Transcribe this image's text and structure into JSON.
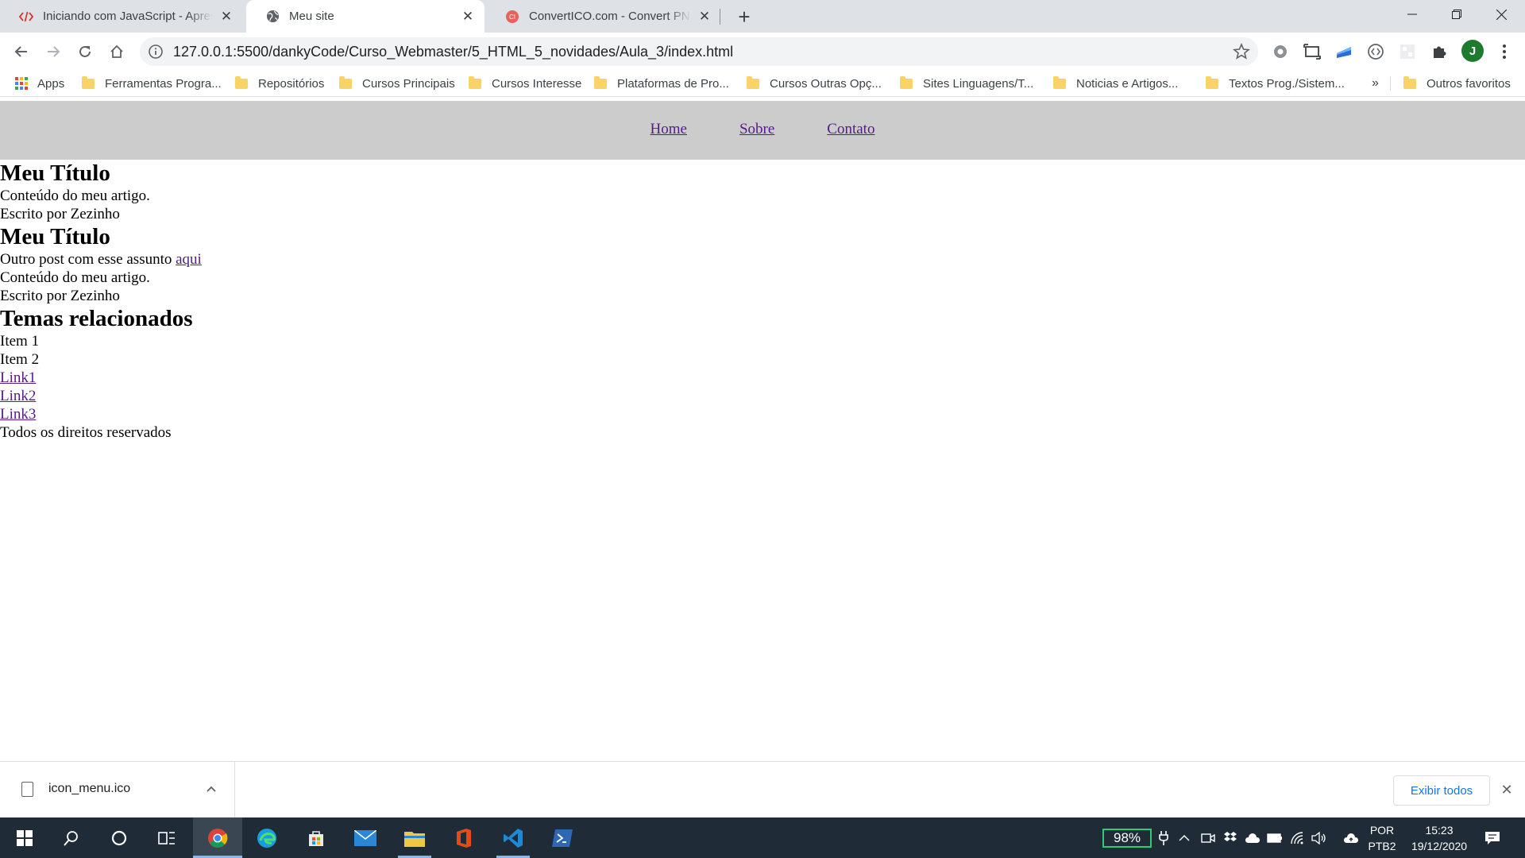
{
  "browser": {
    "tabs": [
      {
        "title": "Iniciando com JavaScript - Apres",
        "icon": "code-icon",
        "active": false
      },
      {
        "title": "Meu site",
        "icon": "globe-icon",
        "active": true
      },
      {
        "title": "ConvertICO.com - Convert PNG t",
        "icon": "converticon-icon",
        "active": false
      }
    ],
    "url": "127.0.0.1:5500/dankyCode/Curso_Webmaster/5_HTML_5_novidades/Aula_3/index.html",
    "avatar_letter": "J",
    "bookmarks": [
      "Apps",
      "Ferramentas Progra...",
      "Repositórios",
      "Cursos Principais",
      "Cursos Interesse",
      "Plataformas de Pro...",
      "Cursos Outras Opç...",
      "Sites Linguagens/T...",
      "Noticias e Artigos...",
      "Textos Prog./Sistem..."
    ],
    "bookmarks_more": "»",
    "bookmarks_other": "Outros favoritos"
  },
  "page": {
    "nav": [
      "Home",
      "Sobre",
      "Contato"
    ],
    "article1": {
      "title": "Meu Título",
      "content": "Conteúdo do meu artigo.",
      "author": "Escrito por Zezinho"
    },
    "article2": {
      "title": "Meu Título",
      "related_text": "Outro post com esse assunto",
      "related_link": "aqui",
      "content": "Conteúdo do meu artigo.",
      "author": "Escrito por Zezinho"
    },
    "aside": {
      "title": "Temas relacionados",
      "items": [
        "Item 1",
        "Item 2"
      ],
      "links": [
        "Link1",
        "Link2",
        "Link3"
      ]
    },
    "footer": "Todos os direitos reservados",
    "link_color": "#551a8b",
    "nav_bg": "#cccccc"
  },
  "downloads": {
    "file": "icon_menu.ico",
    "show_all": "Exibir todos"
  },
  "taskbar": {
    "battery": "98%",
    "lang_top": "POR",
    "lang_bottom": "PTB2",
    "time": "15:23",
    "date": "19/12/2020"
  }
}
